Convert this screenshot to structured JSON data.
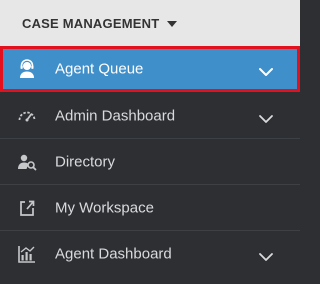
{
  "header": {
    "title": "CASE MANAGEMENT",
    "caret_icon": "caret-down-icon"
  },
  "colors": {
    "header_bg": "#e7e7e7",
    "panel_bg": "#2d2f33",
    "active_bg": "#3f8fcb",
    "highlight_border": "#e3101e",
    "item_text": "#d9dadc",
    "active_text": "#ffffff"
  },
  "nav": {
    "items": [
      {
        "label": "Agent Queue",
        "icon": "agent-headset-icon",
        "expandable": true,
        "active": true
      },
      {
        "label": "Admin Dashboard",
        "icon": "speedometer-icon",
        "expandable": true,
        "active": false
      },
      {
        "label": "Directory",
        "icon": "user-search-icon",
        "expandable": false,
        "active": false
      },
      {
        "label": "My Workspace",
        "icon": "workspace-export-icon",
        "expandable": false,
        "active": false
      },
      {
        "label": "Agent Dashboard",
        "icon": "bar-chart-icon",
        "expandable": true,
        "active": false
      }
    ]
  }
}
